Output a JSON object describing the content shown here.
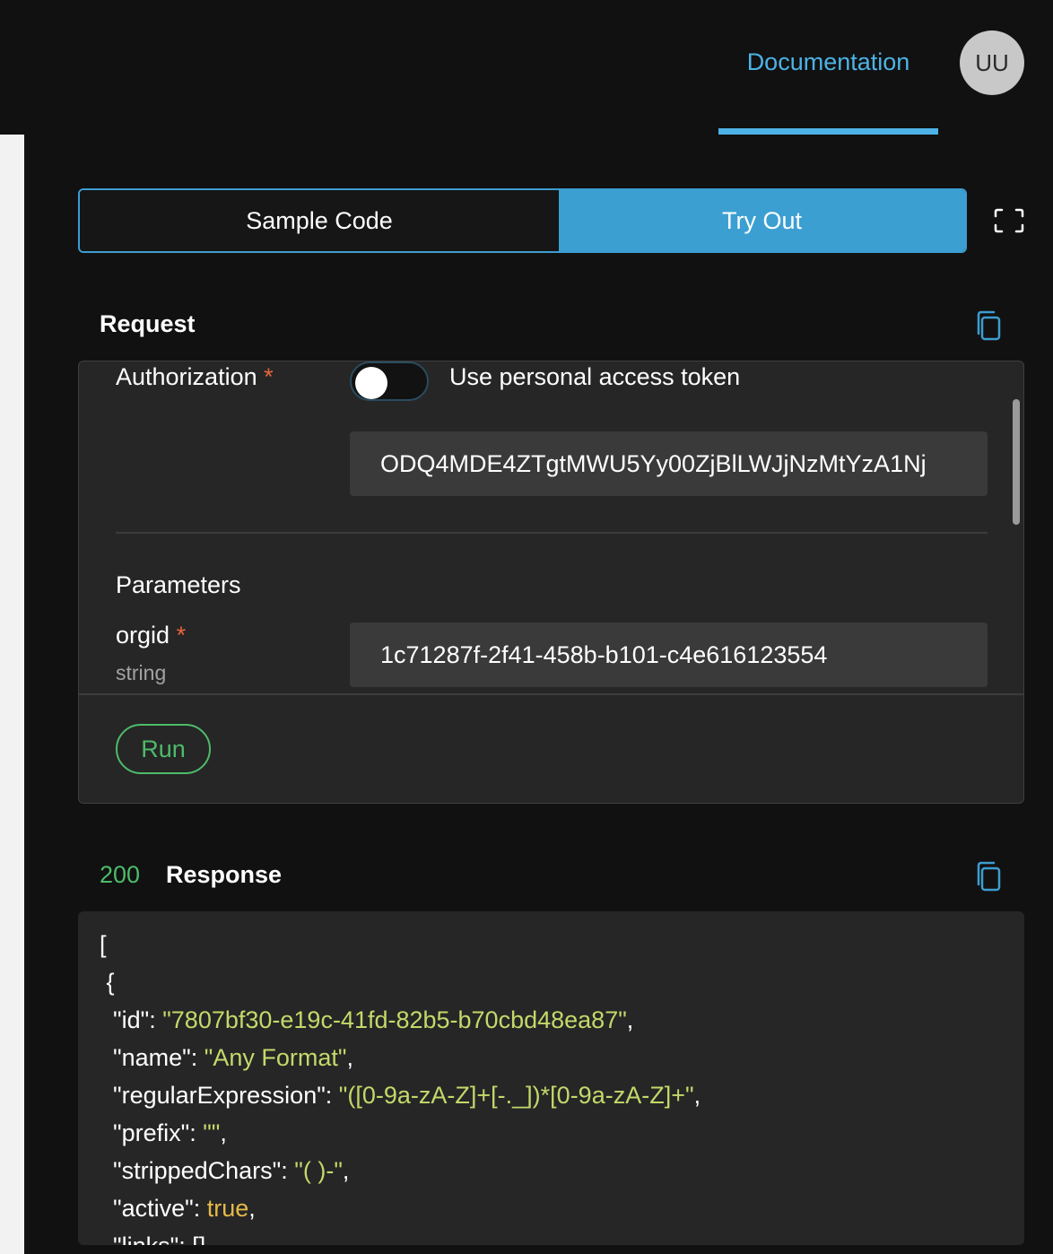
{
  "header": {
    "doc_tab": "Documentation",
    "avatar_initials": "UU",
    "accent": "#4db3e6"
  },
  "mode_switch": {
    "sample_code": "Sample Code",
    "try_out": "Try Out",
    "selected": "Try Out"
  },
  "request": {
    "title": "Request",
    "authorization_label": "Authorization",
    "required_mark": "*",
    "toggle_label": "Use personal access token",
    "toggle_on": false,
    "token_value": "ODQ4MDE4ZTgtMWU5Yy00ZjBlLWJjNzMtYzA1Nj",
    "parameters_title": "Parameters",
    "params": [
      {
        "name": "orgid",
        "required_mark": "*",
        "type": "string",
        "value": "1c71287f-2f41-458b-b101-c4e616123554"
      }
    ],
    "run_label": "Run"
  },
  "response": {
    "status_code": "200",
    "title": "Response",
    "lines": [
      {
        "indent": "",
        "parts": [
          {
            "t": "p",
            "v": "["
          }
        ]
      },
      {
        "indent": " ",
        "parts": [
          {
            "t": "p",
            "v": "{"
          }
        ]
      },
      {
        "indent": "  ",
        "parts": [
          {
            "t": "p",
            "v": "\"id\": "
          },
          {
            "t": "s",
            "v": "\"7807bf30-e19c-41fd-82b5-b70cbd48ea87\""
          },
          {
            "t": "p",
            "v": ","
          }
        ]
      },
      {
        "indent": "  ",
        "parts": [
          {
            "t": "p",
            "v": "\"name\": "
          },
          {
            "t": "s",
            "v": "\"Any Format\""
          },
          {
            "t": "p",
            "v": ","
          }
        ]
      },
      {
        "indent": "  ",
        "parts": [
          {
            "t": "p",
            "v": "\"regularExpression\": "
          },
          {
            "t": "s",
            "v": "\"([0-9a-zA-Z]+[-._])*[0-9a-zA-Z]+\""
          },
          {
            "t": "p",
            "v": ","
          }
        ]
      },
      {
        "indent": "  ",
        "parts": [
          {
            "t": "p",
            "v": "\"prefix\": "
          },
          {
            "t": "s",
            "v": "\"\""
          },
          {
            "t": "p",
            "v": ","
          }
        ]
      },
      {
        "indent": "  ",
        "parts": [
          {
            "t": "p",
            "v": "\"strippedChars\": "
          },
          {
            "t": "s",
            "v": "\"( )-\""
          },
          {
            "t": "p",
            "v": ","
          }
        ]
      },
      {
        "indent": "  ",
        "parts": [
          {
            "t": "p",
            "v": "\"active\": "
          },
          {
            "t": "b",
            "v": "true"
          },
          {
            "t": "p",
            "v": ","
          }
        ]
      },
      {
        "indent": "  ",
        "parts": [
          {
            "t": "p",
            "v": "\"links\": []"
          }
        ]
      }
    ]
  }
}
